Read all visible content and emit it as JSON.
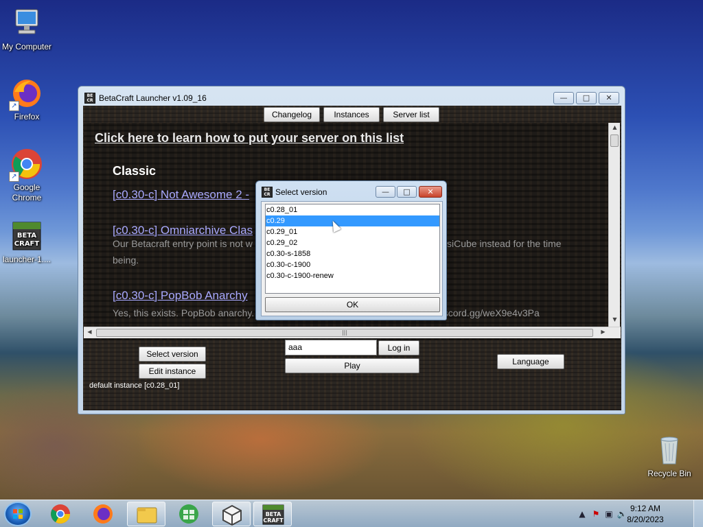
{
  "desktop": {
    "icons": [
      {
        "label": "My Computer"
      },
      {
        "label": "Firefox"
      },
      {
        "label": "Google Chrome"
      },
      {
        "label": "launcher-1...."
      },
      {
        "label": "Recycle Bin"
      }
    ]
  },
  "main_window": {
    "title": "BetaCraft Launcher v1.09_16",
    "icon_text": "BETA CRAFT",
    "tabs": [
      "Changelog",
      "Instances",
      "Server list"
    ],
    "server_list": {
      "header_link": "Click here to learn how to put your server on this list",
      "section": "Classic",
      "servers": [
        {
          "name": "[c0.30-c] Not Awesome 2 -",
          "desc": ""
        },
        {
          "name": "[c0.30-c] Omniarchive Clas",
          "desc_left": "Our Betacraft entry point is not w",
          "desc_right": "ssiCube instead for the time",
          "desc_line2": "being."
        },
        {
          "name": "[c0.30-c] PopBob Anarchy",
          "desc": "Yes, this exists. PopBob anarchy. Owned by popdyne. Discord link is https://discord.gg/weX9e4v3Pa"
        }
      ]
    },
    "bottom": {
      "select_version": "Select version",
      "edit_instance": "Edit instance",
      "username_value": "aaa",
      "login": "Log in",
      "play": "Play",
      "language": "Language",
      "instance_label": "default instance [c0.28_01]"
    }
  },
  "dialog": {
    "title": "Select version",
    "versions": [
      "c0.28_01",
      "c0.29",
      "c0.29_01",
      "c0.29_02",
      "c0.30-s-1858",
      "c0.30-c-1900",
      "c0.30-c-1900-renew"
    ],
    "selected": "c0.29",
    "ok": "OK"
  },
  "taskbar": {
    "time": "9:12 AM",
    "date": "8/20/2023"
  },
  "colors": {
    "selection": "#3399ff",
    "link": "#a9a9ff",
    "close_red": "#c8432b"
  }
}
